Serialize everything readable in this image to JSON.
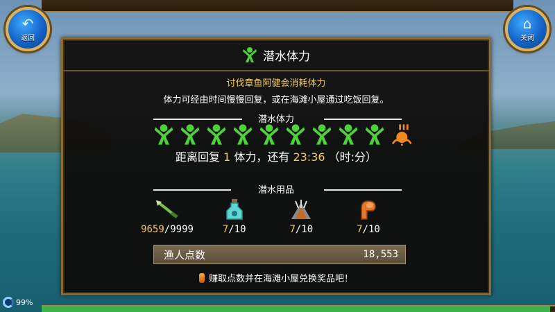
{
  "top": {
    "back_label": "返回",
    "close_label": "关闭"
  },
  "dialog": {
    "title": "潜水体力",
    "subtitle": "讨伐章鱼阿健会消耗体力",
    "description": "体力可经由时间慢慢回复，或在海滩小屋通过吃饭回复。",
    "stamina_section_label": "潜水体力",
    "stamina_full": 9,
    "stamina_extra_icon": "orange-octopus-icon",
    "recovery": {
      "prefix": "距离回复",
      "amount": "1",
      "middle": "体力，还有",
      "time": "23:36",
      "suffix": "（时:分）"
    },
    "supplies_section_label": "潜水用品",
    "supplies": [
      {
        "icon": "harpoon-icon",
        "current": "9659",
        "max": "/9999"
      },
      {
        "icon": "potion-bottle-icon",
        "current": "7",
        "max": "/10"
      },
      {
        "icon": "net-trap-icon",
        "current": "7",
        "max": "/10"
      },
      {
        "icon": "muscle-arm-icon",
        "current": "7",
        "max": "/10"
      }
    ],
    "points_label": "渔人点数",
    "points_value": "18,553",
    "hint": "赚取点数并在海滩小屋兑换奖品吧！"
  },
  "status": {
    "battery": "99%",
    "progress": 0.99
  },
  "colors": {
    "accent_gold": "#f4c95a",
    "stamina_green": "#4fd13c",
    "frame_brown": "#8b6a32"
  }
}
